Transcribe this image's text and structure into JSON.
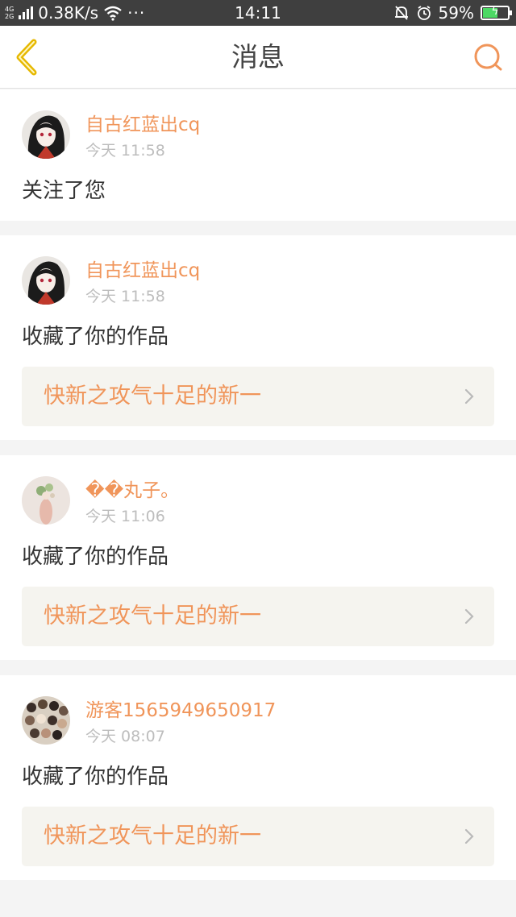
{
  "status_bar": {
    "network_top": "4G",
    "network_bottom": "2G",
    "speed": "0.38K/s",
    "more": "···",
    "time": "14:11",
    "battery_percent": "59%",
    "battery_level": 0.59
  },
  "header": {
    "title": "消息"
  },
  "messages": [
    {
      "user": "自古红蓝出cq",
      "time": "今天 11:58",
      "action": "关注了您"
    },
    {
      "user": "自古红蓝出cq",
      "time": "今天 11:58",
      "action": "收藏了你的作品",
      "work_title": "快新之攻气十足的新一"
    },
    {
      "user": "��丸子。",
      "time": "今天 11:06",
      "action": "收藏了你的作品",
      "work_title": "快新之攻气十足的新一"
    },
    {
      "user": "游客1565949650917",
      "time": "今天 08:07",
      "action": "收藏了你的作品",
      "work_title": "快新之攻气十足的新一"
    }
  ],
  "colors": {
    "accent": "#f0955a",
    "back_arrow": "#e6b800",
    "status_bar": "#3f3f3f",
    "page_bg": "#f4f4f4"
  },
  "icons": {
    "back": "chevron-left-icon",
    "search": "search-icon",
    "work_link": "chevron-right-icon"
  }
}
